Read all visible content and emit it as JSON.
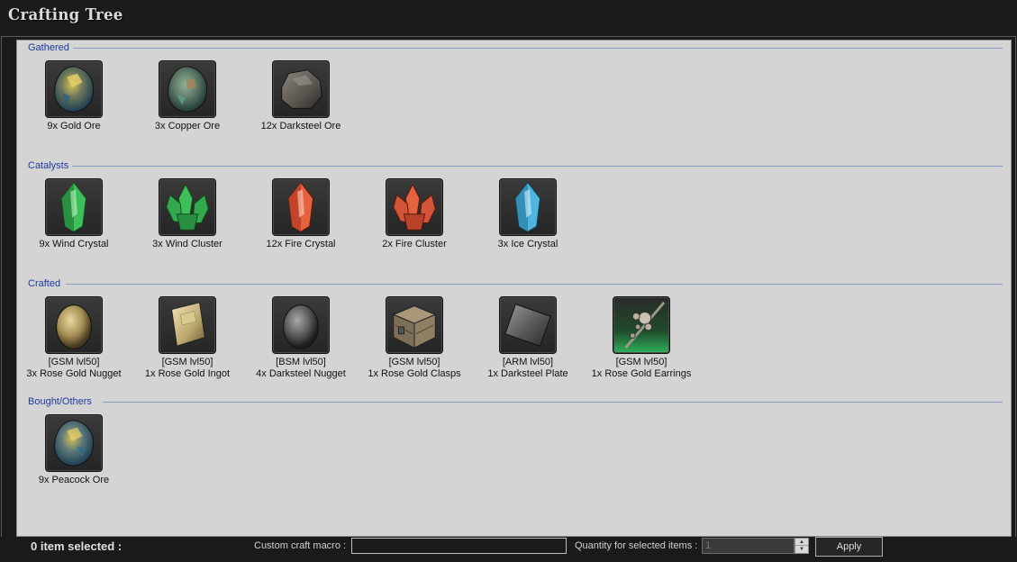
{
  "window": {
    "title": "Crafting Tree"
  },
  "sections": {
    "gathered": {
      "title": "Gathered",
      "items": [
        {
          "label": "9x Gold Ore",
          "icon": "gold-ore-icon"
        },
        {
          "label": "3x Copper Ore",
          "icon": "copper-ore-icon"
        },
        {
          "label": "12x Darksteel Ore",
          "icon": "darksteel-ore-icon"
        }
      ]
    },
    "catalysts": {
      "title": "Catalysts",
      "items": [
        {
          "label": "9x Wind Crystal",
          "icon": "wind-crystal-icon"
        },
        {
          "label": "3x Wind Cluster",
          "icon": "wind-cluster-icon"
        },
        {
          "label": "12x Fire Crystal",
          "icon": "fire-crystal-icon"
        },
        {
          "label": "2x Fire Cluster",
          "icon": "fire-cluster-icon"
        },
        {
          "label": "3x Ice Crystal",
          "icon": "ice-crystal-icon"
        }
      ]
    },
    "crafted": {
      "title": "Crafted",
      "items": [
        {
          "tag": "[GSM lvl50]",
          "label": "3x Rose Gold Nugget",
          "icon": "rose-gold-nugget-icon"
        },
        {
          "tag": "[GSM lvl50]",
          "label": "1x Rose Gold Ingot",
          "icon": "rose-gold-ingot-icon"
        },
        {
          "tag": "[BSM lvl50]",
          "label": "4x Darksteel Nugget",
          "icon": "darksteel-nugget-icon"
        },
        {
          "tag": "[GSM lvl50]",
          "label": "1x Rose Gold Clasps",
          "icon": "rose-gold-clasps-icon"
        },
        {
          "tag": "[ARM lvl50]",
          "label": "1x Darksteel Plate",
          "icon": "darksteel-plate-icon"
        },
        {
          "tag": "[GSM lvl50]",
          "label": "1x Rose Gold Earrings",
          "icon": "rose-gold-earrings-icon"
        }
      ]
    },
    "bought": {
      "title": "Bought/Others",
      "items": [
        {
          "label": "9x Peacock Ore",
          "icon": "peacock-ore-icon"
        }
      ]
    }
  },
  "footer": {
    "selected_text": "0 item selected :",
    "macro_label": "Custom craft macro :",
    "macro_value": "",
    "quantity_label": "Quantity for selected items :",
    "quantity_value": "1",
    "apply_label": "Apply"
  },
  "colors": {
    "panel_bg": "#d4d4d4",
    "section_title": "#1d3a9c",
    "section_line": "#8b9cc2",
    "window_bg": "#1a1a1a"
  }
}
